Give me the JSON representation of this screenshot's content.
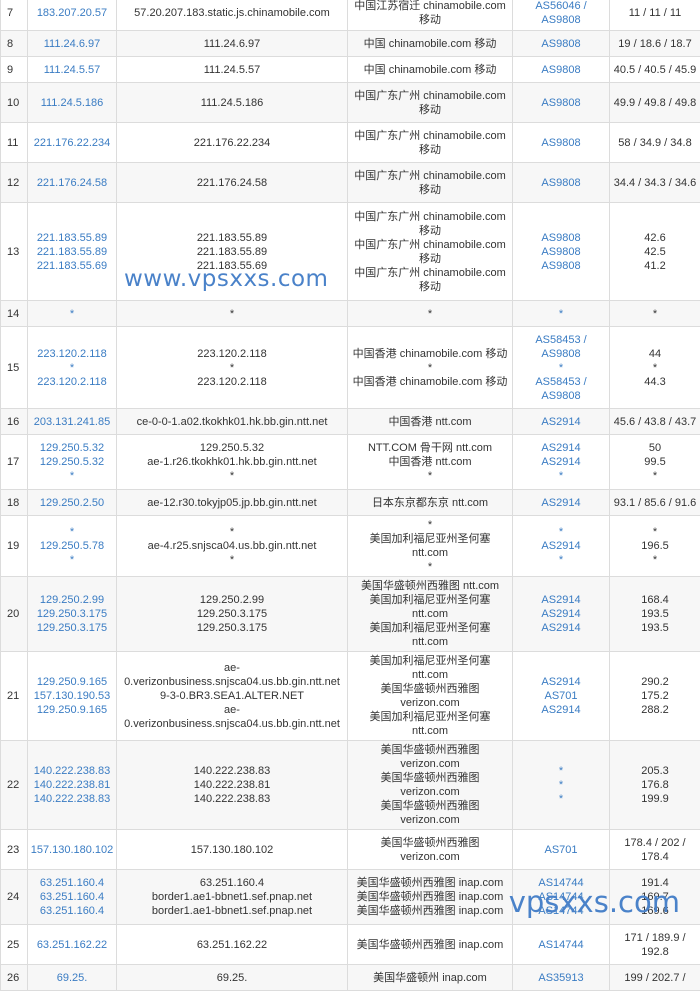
{
  "watermark_top": "www.vpsxxs.com",
  "watermark_bottom": "vpsxxs.com",
  "rows": [
    {
      "hop": "7",
      "ip": [
        "183.207.20.57"
      ],
      "host": [
        "57.20.207.183.static.js.chinamobile.com"
      ],
      "loc": [
        "中国江苏宿迁 chinamobile.com",
        "移动"
      ],
      "asn": [
        "AS56046 /",
        "AS9808"
      ],
      "lat": [
        "11 / 11 / 11"
      ],
      "h": 36
    },
    {
      "hop": "8",
      "ip": [
        "111.24.6.97"
      ],
      "host": [
        "111.24.6.97"
      ],
      "loc": [
        "中国 chinamobile.com 移动"
      ],
      "asn": [
        "AS9808"
      ],
      "lat": [
        "19 / 18.6 / 18.7"
      ],
      "h": 26
    },
    {
      "hop": "9",
      "ip": [
        "111.24.5.57"
      ],
      "host": [
        "111.24.5.57"
      ],
      "loc": [
        "中国 chinamobile.com 移动"
      ],
      "asn": [
        "AS9808"
      ],
      "lat": [
        "40.5 / 40.5 / 45.9"
      ],
      "h": 26
    },
    {
      "hop": "10",
      "ip": [
        "111.24.5.186"
      ],
      "host": [
        "111.24.5.186"
      ],
      "loc": [
        "中国广东广州 chinamobile.com",
        "移动"
      ],
      "asn": [
        "AS9808"
      ],
      "lat": [
        "49.9 / 49.8 / 49.8"
      ],
      "h": 40
    },
    {
      "hop": "11",
      "ip": [
        "221.176.22.234"
      ],
      "host": [
        "221.176.22.234"
      ],
      "loc": [
        "中国广东广州 chinamobile.com",
        "移动"
      ],
      "asn": [
        "AS9808"
      ],
      "lat": [
        "58 / 34.9 / 34.8"
      ],
      "h": 40
    },
    {
      "hop": "12",
      "ip": [
        "221.176.24.58"
      ],
      "host": [
        "221.176.24.58"
      ],
      "loc": [
        "中国广东广州 chinamobile.com",
        "移动"
      ],
      "asn": [
        "AS9808"
      ],
      "lat": [
        "34.4 / 34.3 / 34.6"
      ],
      "h": 40
    },
    {
      "hop": "13",
      "ip": [
        "221.183.55.89",
        "221.183.55.89",
        "221.183.55.69"
      ],
      "host": [
        "221.183.55.89",
        "221.183.55.89",
        "221.183.55.69"
      ],
      "loc": [
        "中国广东广州 chinamobile.com",
        "移动",
        "中国广东广州 chinamobile.com",
        "移动",
        "中国广东广州 chinamobile.com",
        "移动"
      ],
      "asn": [
        "AS9808",
        "AS9808",
        "AS9808"
      ],
      "lat": [
        "42.6",
        "42.5",
        "41.2"
      ],
      "h": 98
    },
    {
      "hop": "14",
      "ip": [
        "*"
      ],
      "host": [
        "*"
      ],
      "loc": [
        "*"
      ],
      "asn": [
        "*"
      ],
      "lat": [
        "*"
      ],
      "h": 26
    },
    {
      "hop": "15",
      "ip": [
        "223.120.2.118",
        "*",
        "223.120.2.118"
      ],
      "host": [
        "223.120.2.118",
        "*",
        "223.120.2.118"
      ],
      "loc": [
        "中国香港 chinamobile.com 移动",
        "*",
        "中国香港 chinamobile.com 移动"
      ],
      "asn": [
        "AS58453 /",
        "AS9808",
        "*",
        "AS58453 /",
        "AS9808"
      ],
      "lat": [
        "44",
        "*",
        "44.3"
      ],
      "h": 82
    },
    {
      "hop": "16",
      "ip": [
        "203.131.241.85"
      ],
      "host": [
        "ce-0-0-1.a02.tkokhk01.hk.bb.gin.ntt.net"
      ],
      "loc": [
        "中国香港 ntt.com"
      ],
      "asn": [
        "AS2914"
      ],
      "lat": [
        "45.6 / 43.8 / 43.7"
      ],
      "h": 26
    },
    {
      "hop": "17",
      "ip": [
        "129.250.5.32",
        "129.250.5.32",
        "*"
      ],
      "host": [
        "129.250.5.32",
        "ae-1.r26.tkokhk01.hk.bb.gin.ntt.net",
        "*"
      ],
      "loc": [
        "NTT.COM 骨干网 ntt.com",
        "中国香港 ntt.com",
        "*"
      ],
      "asn": [
        "AS2914",
        "AS2914",
        "*"
      ],
      "lat": [
        "50",
        "99.5",
        "*"
      ],
      "h": 55
    },
    {
      "hop": "18",
      "ip": [
        "129.250.2.50"
      ],
      "host": [
        "ae-12.r30.tokyjp05.jp.bb.gin.ntt.net"
      ],
      "loc": [
        "日本东京都东京 ntt.com"
      ],
      "asn": [
        "AS2914"
      ],
      "lat": [
        "93.1 / 85.6 / 91.6"
      ],
      "h": 26
    },
    {
      "hop": "19",
      "ip": [
        "*",
        "129.250.5.78",
        "*"
      ],
      "host": [
        "*",
        "ae-4.r25.snjsca04.us.bb.gin.ntt.net",
        "*"
      ],
      "loc": [
        "*",
        "美国加利福尼亚州圣何塞 ntt.com",
        "*"
      ],
      "asn": [
        "*",
        "AS2914",
        "*"
      ],
      "lat": [
        "*",
        "196.5",
        "*"
      ],
      "h": 55
    },
    {
      "hop": "20",
      "ip": [
        "129.250.2.99",
        "129.250.3.175",
        "129.250.3.175"
      ],
      "host": [
        "129.250.2.99",
        "129.250.3.175",
        "129.250.3.175"
      ],
      "loc": [
        "美国华盛顿州西雅图 ntt.com",
        "美国加利福尼亚州圣何塞 ntt.com",
        "美国加利福尼亚州圣何塞 ntt.com"
      ],
      "asn": [
        "AS2914",
        "AS2914",
        "AS2914"
      ],
      "lat": [
        "168.4",
        "193.5",
        "193.5"
      ],
      "h": 55
    },
    {
      "hop": "21",
      "ip": [
        "129.250.9.165",
        "157.130.190.53",
        "129.250.9.165"
      ],
      "host": [
        "ae-",
        "0.verizonbusiness.snjsca04.us.bb.gin.ntt.net",
        "9-3-0.BR3.SEA1.ALTER.NET",
        "ae-",
        "0.verizonbusiness.snjsca04.us.bb.gin.ntt.net"
      ],
      "loc": [
        "美国加利福尼亚州圣何塞 ntt.com",
        "美国华盛顿州西雅图 verizon.com",
        "美国加利福尼亚州圣何塞 ntt.com"
      ],
      "asn": [
        "AS2914",
        "AS701",
        "AS2914"
      ],
      "lat": [
        "290.2",
        "175.2",
        "288.2"
      ],
      "h": 84
    },
    {
      "hop": "22",
      "ip": [
        "140.222.238.83",
        "140.222.238.81",
        "140.222.238.83"
      ],
      "host": [
        "140.222.238.83",
        "140.222.238.81",
        "140.222.238.83"
      ],
      "loc": [
        "美国华盛顿州西雅图 verizon.com",
        "美国华盛顿州西雅图 verizon.com",
        "美国华盛顿州西雅图 verizon.com"
      ],
      "asn": [
        "*",
        "*",
        "*"
      ],
      "lat": [
        "205.3",
        "176.8",
        "199.9"
      ],
      "h": 55
    },
    {
      "hop": "23",
      "ip": [
        "157.130.180.102"
      ],
      "host": [
        "157.130.180.102"
      ],
      "loc": [
        "美国华盛顿州西雅图 verizon.com"
      ],
      "asn": [
        "AS701"
      ],
      "lat": [
        "178.4 / 202 /",
        "178.4"
      ],
      "h": 40
    },
    {
      "hop": "24",
      "ip": [
        "63.251.160.4",
        "63.251.160.4",
        "63.251.160.4"
      ],
      "host": [
        "63.251.160.4",
        "border1.ae1-bbnet1.sef.pnap.net",
        "border1.ae1-bbnet1.sef.pnap.net"
      ],
      "loc": [
        "美国华盛顿州西雅图 inap.com",
        "美国华盛顿州西雅图 inap.com",
        "美国华盛顿州西雅图 inap.com"
      ],
      "asn": [
        "AS14744",
        "AS14744",
        "AS14744"
      ],
      "lat": [
        "191.4",
        "169.7",
        "169.6"
      ],
      "h": 55
    },
    {
      "hop": "25",
      "ip": [
        "63.251.162.22"
      ],
      "host": [
        "63.251.162.22"
      ],
      "loc": [
        "美国华盛顿州西雅图 inap.com"
      ],
      "asn": [
        "AS14744"
      ],
      "lat": [
        "171 / 189.9 /",
        "192.8"
      ],
      "h": 40
    },
    {
      "hop": "26",
      "ip": [
        "69.25."
      ],
      "host": [
        "69.25."
      ],
      "loc": [
        "美国华盛顿州 inap.com"
      ],
      "asn": [
        "AS35913"
      ],
      "lat": [
        "199 / 202.7 /"
      ],
      "h": 26
    }
  ]
}
